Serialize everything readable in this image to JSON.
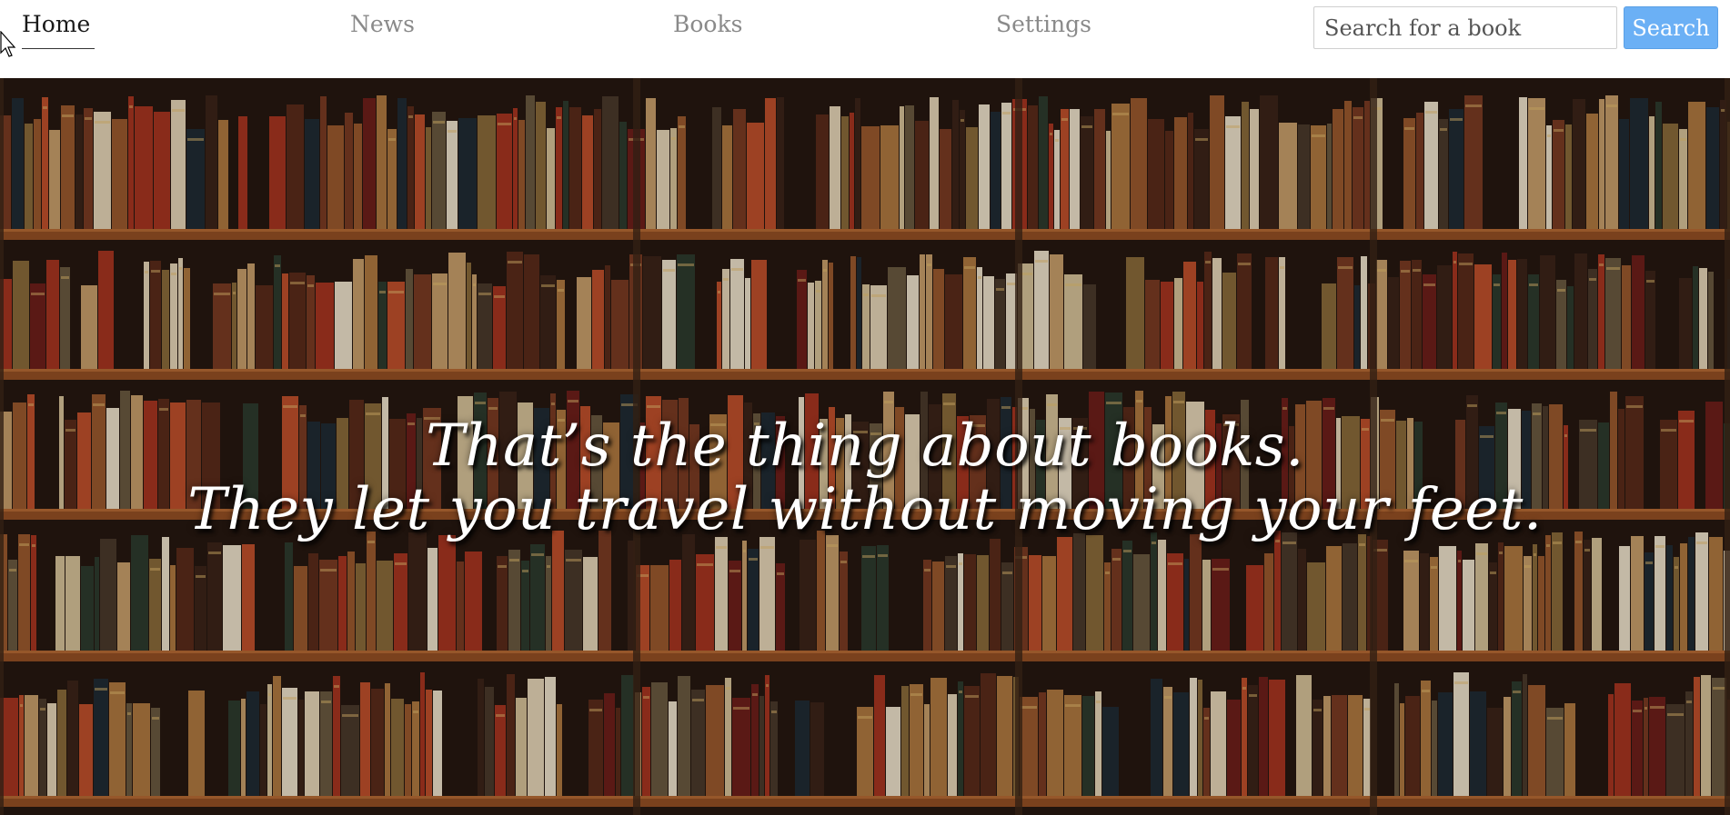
{
  "nav": {
    "items": [
      {
        "label": "Home",
        "active": true
      },
      {
        "label": "News",
        "active": false
      },
      {
        "label": "Books",
        "active": false
      },
      {
        "label": "Settings",
        "active": false
      }
    ]
  },
  "search": {
    "placeholder": "Search for a book",
    "value": "",
    "button_label": "Search"
  },
  "hero": {
    "quote_line_1": "That’s the thing about books.",
    "quote_line_2": "They let you travel without moving your feet."
  },
  "colors": {
    "accent": "#6bb0f5",
    "active_nav": "#1a1a1a",
    "inactive_nav": "#8a8a8a",
    "shelf_wood": "#8b4a22"
  }
}
